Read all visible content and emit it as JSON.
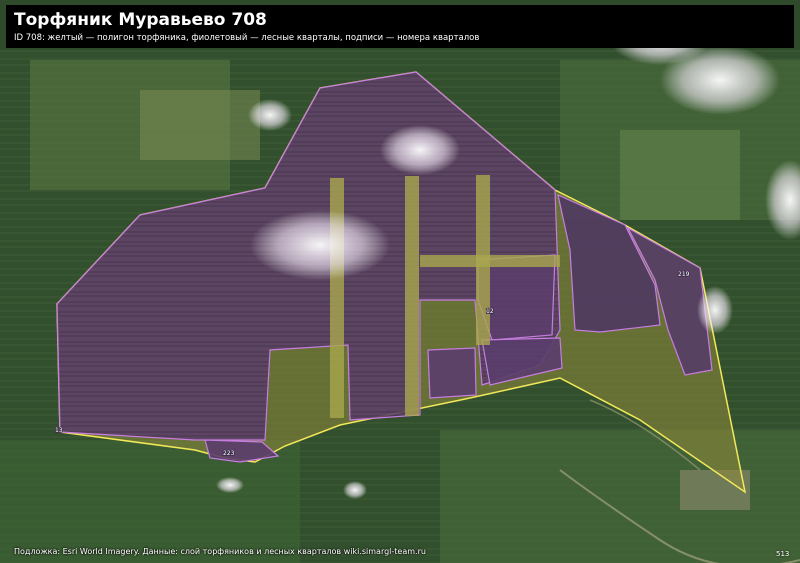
{
  "header": {
    "title": "Торфяник Муравьево 708",
    "subtitle": "ID 708: желтый — полигон торфяника, фиолетовый — лесные кварталы, подписи — номера кварталов"
  },
  "footer": {
    "attribution": "Подложка: Esri World Imagery. Данные: слой торфяников и лесных кварталов wiki.simargl-team.ru",
    "corner_mark": "513"
  },
  "quarters": [
    {
      "number": "12"
    },
    {
      "number": "219"
    },
    {
      "number": "13"
    },
    {
      "number": "223"
    }
  ],
  "legend_colors": {
    "peatland": "#f2e85a",
    "forest_quarters": "#c77ee0"
  }
}
